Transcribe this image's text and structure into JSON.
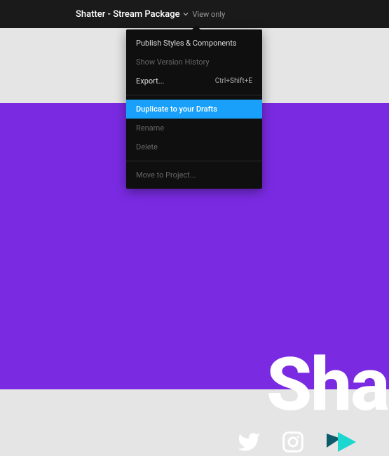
{
  "header": {
    "title": "Shatter - Stream Package",
    "view_tag": "View only"
  },
  "menu": {
    "publish": "Publish Styles & Components",
    "version_history": "Show Version History",
    "export": "Export...",
    "export_shortcut": "Ctrl+Shift+E",
    "duplicate": "Duplicate to your Drafts",
    "rename": "Rename",
    "delete": "Delete",
    "move": "Move to Project..."
  },
  "canvas": {
    "headline": "Sha"
  }
}
